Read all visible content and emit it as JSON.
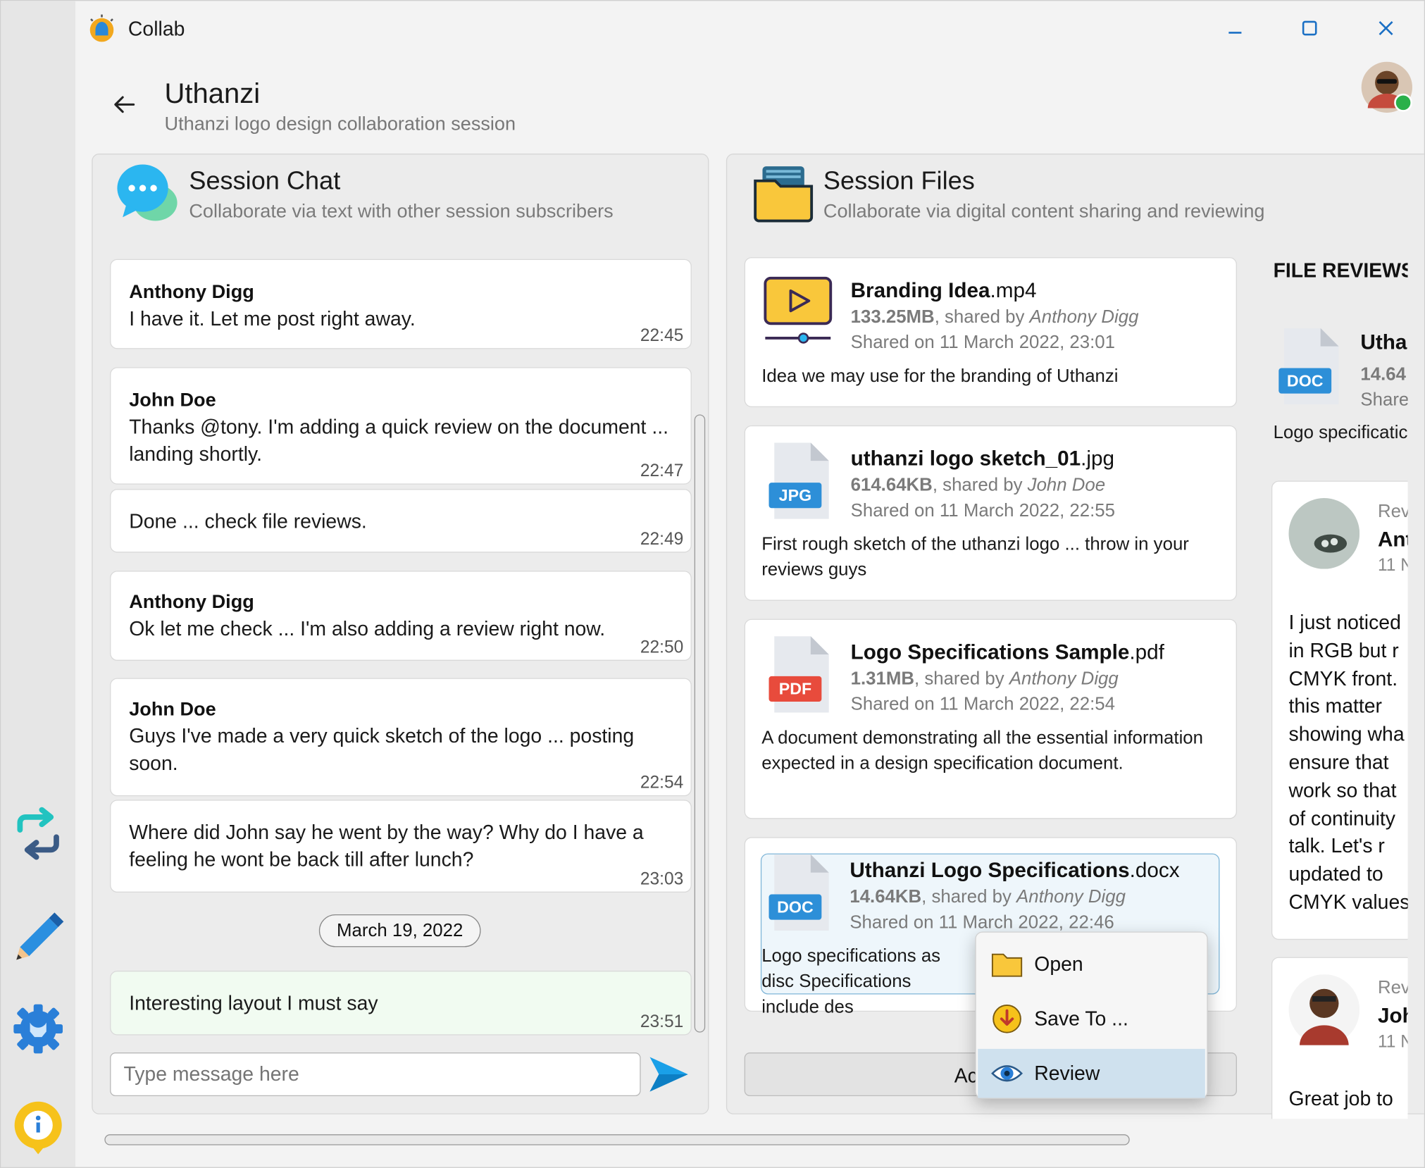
{
  "app": {
    "title": "Collab"
  },
  "header": {
    "title": "Uthanzi",
    "subtitle": "Uthanzi logo design collaboration session"
  },
  "chat": {
    "title": "Session Chat",
    "subtitle": "Collaborate via text with other session subscribers",
    "messages": [
      {
        "author": "Anthony Digg",
        "text": "I have it. Let me post right away.",
        "time": "22:45"
      },
      {
        "author": "John Doe",
        "text": "Thanks @tony. I'm adding a quick review on the document ... landing shortly.",
        "time": "22:47"
      },
      {
        "author": "",
        "text": "Done ... check file reviews.",
        "time": "22:49"
      },
      {
        "author": "Anthony Digg",
        "text": "Ok let me check ... I'm also adding a review right now.",
        "time": "22:50"
      },
      {
        "author": "John Doe",
        "text": "Guys I've made a very quick sketch of the logo ... posting soon.",
        "time": "22:54"
      },
      {
        "author": "",
        "text": "Where did John say he went by the way? Why do I have a feeling he wont be back till after lunch?",
        "time": "23:03"
      },
      {
        "author": "",
        "text": "Interesting layout I must say",
        "time": "23:51"
      }
    ],
    "date_separator": "March 19, 2022",
    "input_placeholder": "Type message here"
  },
  "files": {
    "title": "Session Files",
    "subtitle": "Collaborate via digital content sharing and reviewing",
    "items": [
      {
        "name": "Branding Idea",
        "ext": ".mp4",
        "size": "133.25MB",
        "shared_by_prefix": ", shared by ",
        "shared_by": "Anthony Digg",
        "shared_on": "Shared on 11 March 2022, 23:01",
        "description": "Idea we may use for the branding of Uthanzi",
        "icon": "video-icon"
      },
      {
        "name": "uthanzi logo sketch_01",
        "ext": ".jpg",
        "size": "614.64KB",
        "shared_by_prefix": ", shared by ",
        "shared_by": "John Doe",
        "shared_on": "Shared on 11 March 2022, 22:55",
        "description": "First rough sketch of the uthanzi logo ... throw in your reviews guys",
        "badge": "JPG",
        "badge_color": "#2d8fd8"
      },
      {
        "name": "Logo Specifications Sample",
        "ext": ".pdf",
        "size": "1.31MB",
        "shared_by_prefix": ", shared by ",
        "shared_by": "Anthony Digg",
        "shared_on": "Shared on 11 March 2022, 22:54",
        "description": "A document demonstrating all the essential information expected in a design specification document.",
        "badge": "PDF",
        "badge_color": "#e84b3c"
      },
      {
        "name": "Uthanzi Logo Specifications",
        "ext": ".docx",
        "size": "14.64KB",
        "shared_by_prefix": ", shared by ",
        "shared_by": "Anthony Digg",
        "shared_on": "Shared on 11 March 2022, 22:46",
        "description": "Logo specifications as disc Specifications include des",
        "badge": "DOC",
        "badge_color": "#2d8fd8"
      }
    ],
    "add_button_label": "Ac"
  },
  "reviews": {
    "title": "FILE REVIEWS",
    "file_name": "Utha",
    "file_size": "14.64",
    "file_shared": "Share",
    "file_desc": "Logo specificatic",
    "file_badge": "DOC",
    "items": [
      {
        "label": "Rev",
        "author": "Ant",
        "date": "11 N",
        "body_lines": [
          "I just noticed",
          "in RGB but r",
          "CMYK front.",
          "this matter",
          "showing wha",
          "ensure that",
          "work so that",
          "of continuity",
          "talk. Let's r",
          "updated to",
          "CMYK values"
        ]
      },
      {
        "label": "Rev",
        "author": "Joh",
        "date": "11 N",
        "body_lines": [
          "Great job to"
        ]
      }
    ]
  },
  "context_menu": {
    "items": [
      {
        "label": "Open",
        "icon": "folder-icon"
      },
      {
        "label": "Save To ...",
        "icon": "download-icon"
      },
      {
        "label": "Review",
        "icon": "eye-icon",
        "highlighted": true
      }
    ]
  },
  "colors": {
    "accent": "#1aa0e8",
    "selected_border": "#7fb6d8",
    "menu_highlight": "#cfe1ee"
  }
}
